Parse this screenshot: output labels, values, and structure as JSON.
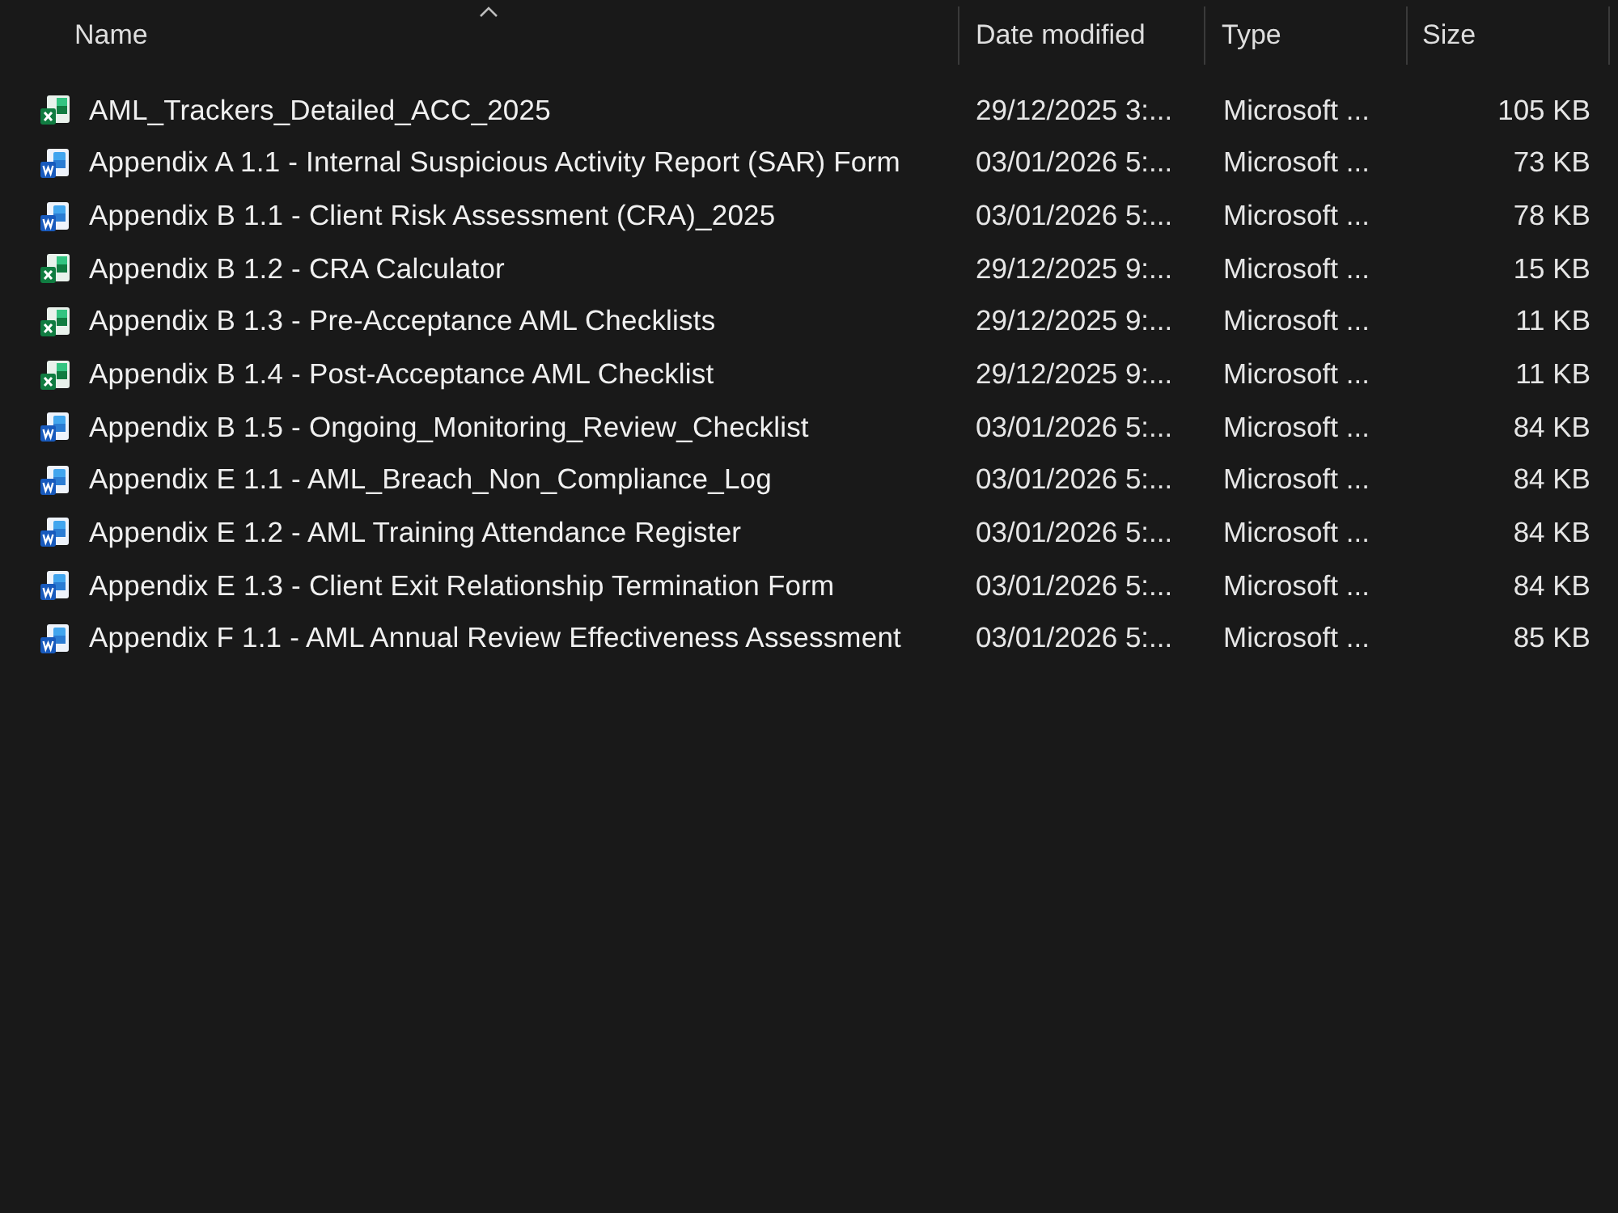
{
  "columns": [
    {
      "label": "Name",
      "sorted": true
    },
    {
      "label": "Date modified",
      "sorted": false
    },
    {
      "label": "Type",
      "sorted": false
    },
    {
      "label": "Size",
      "sorted": false
    }
  ],
  "rows": [
    {
      "kind": "excel",
      "name": "AML_Trackers_Detailed_ACC_2025",
      "date": "29/12/2025 3:...",
      "type": "Microsoft ...",
      "size": "105 KB"
    },
    {
      "kind": "word",
      "name": "Appendix A 1.1 - Internal Suspicious Activity Report (SAR) Form",
      "date": "03/01/2026 5:...",
      "type": "Microsoft ...",
      "size": "73 KB"
    },
    {
      "kind": "word",
      "name": "Appendix B 1.1 - Client Risk Assessment (CRA)_2025",
      "date": "03/01/2026 5:...",
      "type": "Microsoft ...",
      "size": "78 KB"
    },
    {
      "kind": "excel",
      "name": "Appendix B 1.2 - CRA Calculator",
      "date": "29/12/2025 9:...",
      "type": "Microsoft ...",
      "size": "15 KB"
    },
    {
      "kind": "excel",
      "name": "Appendix B 1.3 - Pre-Acceptance AML Checklists",
      "date": "29/12/2025 9:...",
      "type": "Microsoft ...",
      "size": "11 KB"
    },
    {
      "kind": "excel",
      "name": "Appendix B 1.4 - Post-Acceptance AML Checklist",
      "date": "29/12/2025 9:...",
      "type": "Microsoft ...",
      "size": "11 KB"
    },
    {
      "kind": "word",
      "name": "Appendix B 1.5 - Ongoing_Monitoring_Review_Checklist",
      "date": "03/01/2026 5:...",
      "type": "Microsoft ...",
      "size": "84 KB"
    },
    {
      "kind": "word",
      "name": "Appendix E 1.1 - AML_Breach_Non_Compliance_Log",
      "date": "03/01/2026 5:...",
      "type": "Microsoft ...",
      "size": "84 KB"
    },
    {
      "kind": "word",
      "name": "Appendix E 1.2 - AML Training Attendance Register",
      "date": "03/01/2026 5:...",
      "type": "Microsoft ...",
      "size": "84 KB"
    },
    {
      "kind": "word",
      "name": "Appendix E 1.3 - Client Exit Relationship Termination Form",
      "date": "03/01/2026 5:...",
      "type": "Microsoft ...",
      "size": "84 KB"
    },
    {
      "kind": "word",
      "name": "Appendix F 1.1 - AML Annual Review Effectiveness Assessment",
      "date": "03/01/2026 5:...",
      "type": "Microsoft ...",
      "size": "85 KB"
    }
  ]
}
